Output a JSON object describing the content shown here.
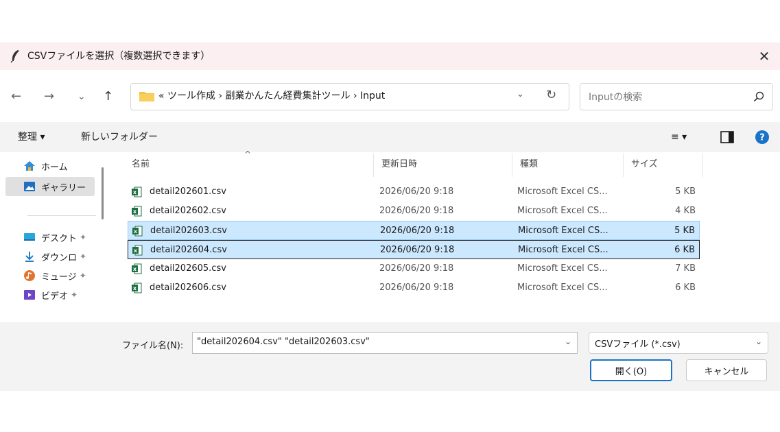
{
  "window": {
    "title": "CSVファイルを選択（複数選択できます）",
    "close": "✕"
  },
  "nav": {
    "back": "←",
    "forward": "→",
    "recent": "⌄",
    "up": "↑",
    "breadcrumb": "«  ツール作成  ›  副業かんたん経費集計ツール  ›  Input",
    "dropdown": "⌄",
    "refresh": "↻",
    "search_placeholder": "Inputの検索"
  },
  "toolbar": {
    "organize": "整理 ▾",
    "new_folder": "新しいフォルダー",
    "view": "≡ ▾"
  },
  "sidebar": {
    "items": [
      {
        "label": "ホーム",
        "icon": "home-icon",
        "pinned": ""
      },
      {
        "label": "ギャラリー",
        "icon": "gallery-icon",
        "pinned": ""
      },
      {
        "label": "デスクト",
        "icon": "desktop-icon",
        "pinned": "📌"
      },
      {
        "label": "ダウンロ",
        "icon": "download-icon",
        "pinned": "📌"
      },
      {
        "label": "ミュージ",
        "icon": "music-icon",
        "pinned": "📌"
      },
      {
        "label": "ビデオ",
        "icon": "video-icon",
        "pinned": "📌"
      }
    ]
  },
  "columns": {
    "name": "名前",
    "date": "更新日時",
    "type": "種類",
    "size": "サイズ",
    "sort_caret": "^"
  },
  "files": [
    {
      "name": "detail202601.csv",
      "date": "2026/06/20 9:18",
      "type": "Microsoft Excel CS...",
      "size": "5 KB",
      "selected": false
    },
    {
      "name": "detail202602.csv",
      "date": "2026/06/20 9:18",
      "type": "Microsoft Excel CS...",
      "size": "4 KB",
      "selected": false
    },
    {
      "name": "detail202603.csv",
      "date": "2026/06/20 9:18",
      "type": "Microsoft Excel CS...",
      "size": "5 KB",
      "selected": true
    },
    {
      "name": "detail202604.csv",
      "date": "2026/06/20 9:18",
      "type": "Microsoft Excel CS...",
      "size": "6 KB",
      "selected": true
    },
    {
      "name": "detail202605.csv",
      "date": "2026/06/20 9:18",
      "type": "Microsoft Excel CS...",
      "size": "7 KB",
      "selected": false
    },
    {
      "name": "detail202606.csv",
      "date": "2026/06/20 9:18",
      "type": "Microsoft Excel CS...",
      "size": "6 KB",
      "selected": false
    }
  ],
  "footer": {
    "filename_label": "ファイル名(N):",
    "filename_value": "\"detail202604.csv\" \"detail202603.csv\"",
    "filetype": "CSVファイル (*.csv)",
    "open": "開く(O)",
    "cancel": "キャンセル"
  },
  "colors": {
    "accent": "#1a73c7",
    "selection": "#cce8ff",
    "titlebar": "#fbeff2"
  }
}
